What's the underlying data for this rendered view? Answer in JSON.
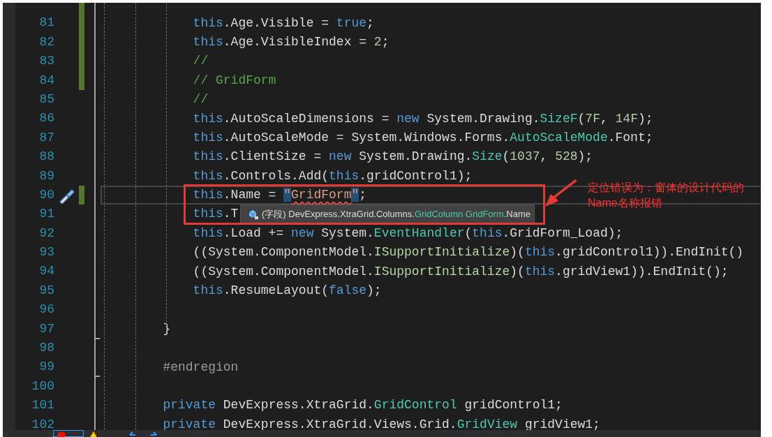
{
  "editor": {
    "lines": [
      {
        "number": "81",
        "changed": true,
        "current": false,
        "tokens": [
          {
            "kind": "keyword",
            "text": "            this"
          },
          {
            "kind": "plain",
            "text": ".Age.Visible = "
          },
          {
            "kind": "keyword",
            "text": "true"
          },
          {
            "kind": "plain",
            "text": ";"
          }
        ]
      },
      {
        "number": "82",
        "changed": true,
        "current": false,
        "tokens": [
          {
            "kind": "keyword",
            "text": "            this"
          },
          {
            "kind": "plain",
            "text": ".Age.VisibleIndex = "
          },
          {
            "kind": "number",
            "text": "2"
          },
          {
            "kind": "plain",
            "text": ";"
          }
        ]
      },
      {
        "number": "83",
        "changed": true,
        "current": false,
        "tokens": [
          {
            "kind": "comment",
            "text": "            //"
          }
        ]
      },
      {
        "number": "84",
        "changed": true,
        "current": false,
        "tokens": [
          {
            "kind": "comment",
            "text": "            // GridForm"
          }
        ]
      },
      {
        "number": "85",
        "changed": false,
        "current": false,
        "tokens": [
          {
            "kind": "comment",
            "text": "            //"
          }
        ]
      },
      {
        "number": "86",
        "changed": false,
        "current": false,
        "tokens": [
          {
            "kind": "keyword",
            "text": "            this"
          },
          {
            "kind": "plain",
            "text": ".AutoScaleDimensions = "
          },
          {
            "kind": "keyword",
            "text": "new"
          },
          {
            "kind": "plain",
            "text": " System.Drawing."
          },
          {
            "kind": "type",
            "text": "SizeF"
          },
          {
            "kind": "plain",
            "text": "("
          },
          {
            "kind": "number",
            "text": "7F"
          },
          {
            "kind": "plain",
            "text": ", "
          },
          {
            "kind": "number",
            "text": "14F"
          },
          {
            "kind": "plain",
            "text": ");"
          }
        ]
      },
      {
        "number": "87",
        "changed": false,
        "current": false,
        "tokens": [
          {
            "kind": "keyword",
            "text": "            this"
          },
          {
            "kind": "plain",
            "text": ".AutoScaleMode = System.Windows.Forms."
          },
          {
            "kind": "type",
            "text": "AutoScaleMode"
          },
          {
            "kind": "plain",
            "text": ".Font;"
          }
        ]
      },
      {
        "number": "88",
        "changed": false,
        "current": false,
        "tokens": [
          {
            "kind": "keyword",
            "text": "            this"
          },
          {
            "kind": "plain",
            "text": ".ClientSize = "
          },
          {
            "kind": "keyword",
            "text": "new"
          },
          {
            "kind": "plain",
            "text": " System.Drawing."
          },
          {
            "kind": "type",
            "text": "Size"
          },
          {
            "kind": "plain",
            "text": "("
          },
          {
            "kind": "number",
            "text": "1037"
          },
          {
            "kind": "plain",
            "text": ", "
          },
          {
            "kind": "number",
            "text": "528"
          },
          {
            "kind": "plain",
            "text": ");"
          }
        ]
      },
      {
        "number": "89",
        "changed": false,
        "current": false,
        "tokens": [
          {
            "kind": "keyword",
            "text": "            this"
          },
          {
            "kind": "plain",
            "text": ".Controls.Add("
          },
          {
            "kind": "keyword",
            "text": "this"
          },
          {
            "kind": "plain",
            "text": ".gridControl1);"
          }
        ]
      },
      {
        "number": "90",
        "changed": true,
        "current": true,
        "tokens": [
          {
            "kind": "keyword",
            "text": "            this"
          },
          {
            "kind": "plain",
            "text": ".Name = "
          },
          {
            "kind": "string",
            "text": "\"",
            "highlighted": true
          },
          {
            "kind": "string",
            "text": "GridForm",
            "error": true
          },
          {
            "kind": "string",
            "text": "\"",
            "highlighted": true
          },
          {
            "kind": "plain",
            "text": ";"
          }
        ]
      },
      {
        "number": "91",
        "changed": false,
        "current": false,
        "tokens": [
          {
            "kind": "keyword",
            "text": "            this"
          },
          {
            "kind": "plain",
            "text": ".T"
          }
        ]
      },
      {
        "number": "92",
        "changed": false,
        "current": false,
        "tokens": [
          {
            "kind": "keyword",
            "text": "            this"
          },
          {
            "kind": "plain",
            "text": ".Load += "
          },
          {
            "kind": "keyword",
            "text": "new"
          },
          {
            "kind": "plain",
            "text": " System."
          },
          {
            "kind": "type",
            "text": "EventHandler"
          },
          {
            "kind": "plain",
            "text": "("
          },
          {
            "kind": "keyword",
            "text": "this"
          },
          {
            "kind": "plain",
            "text": ".GridForm_Load);"
          }
        ]
      },
      {
        "number": "93",
        "changed": false,
        "current": false,
        "tokens": [
          {
            "kind": "plain",
            "text": "            ((System.ComponentModel."
          },
          {
            "kind": "interface",
            "text": "ISupportInitialize"
          },
          {
            "kind": "plain",
            "text": ")("
          },
          {
            "kind": "keyword",
            "text": "this"
          },
          {
            "kind": "plain",
            "text": ".gridControl1)).EndInit()"
          }
        ]
      },
      {
        "number": "94",
        "changed": false,
        "current": false,
        "tokens": [
          {
            "kind": "plain",
            "text": "            ((System.ComponentModel."
          },
          {
            "kind": "interface",
            "text": "ISupportInitialize"
          },
          {
            "kind": "plain",
            "text": ")("
          },
          {
            "kind": "keyword",
            "text": "this"
          },
          {
            "kind": "plain",
            "text": ".gridView1)).EndInit();"
          }
        ]
      },
      {
        "number": "95",
        "changed": false,
        "current": false,
        "tokens": [
          {
            "kind": "keyword",
            "text": "            this"
          },
          {
            "kind": "plain",
            "text": ".ResumeLayout("
          },
          {
            "kind": "keyword",
            "text": "false"
          },
          {
            "kind": "plain",
            "text": ");"
          }
        ]
      },
      {
        "number": "96",
        "changed": false,
        "current": false
      },
      {
        "number": "97",
        "changed": false,
        "current": false,
        "tokens": [
          {
            "kind": "plain",
            "text": "        }"
          }
        ]
      },
      {
        "number": "98",
        "changed": false,
        "current": false
      },
      {
        "number": "99",
        "changed": false,
        "current": false,
        "tokens": [
          {
            "kind": "preproc",
            "text": "        #endregion"
          }
        ]
      },
      {
        "number": "100",
        "changed": false,
        "current": false
      },
      {
        "number": "101",
        "changed": false,
        "current": false,
        "tokens": [
          {
            "kind": "keyword",
            "text": "        private"
          },
          {
            "kind": "plain",
            "text": " DevExpress.XtraGrid."
          },
          {
            "kind": "type",
            "text": "GridControl"
          },
          {
            "kind": "plain",
            "text": " gridControl1;"
          }
        ]
      },
      {
        "number": "102",
        "changed": false,
        "current": false,
        "tokens": [
          {
            "kind": "keyword",
            "text": "        private"
          },
          {
            "kind": "plain",
            "text": " DevExpress.XtraGrid.Views.Grid."
          },
          {
            "kind": "type",
            "text": "GridView"
          },
          {
            "kind": "plain",
            "text": " gridView1;"
          }
        ]
      }
    ]
  },
  "tooltip": {
    "parts": [
      {
        "kind": "plain",
        "text": "(字段) DevExpress.XtraGrid.Columns."
      },
      {
        "kind": "type",
        "text": "GridColumn GridForm"
      },
      {
        "kind": "plain",
        "text": ".Name"
      }
    ]
  },
  "annotation": {
    "text": "定位错误为：窗体的设计代码的Name名称报错"
  }
}
